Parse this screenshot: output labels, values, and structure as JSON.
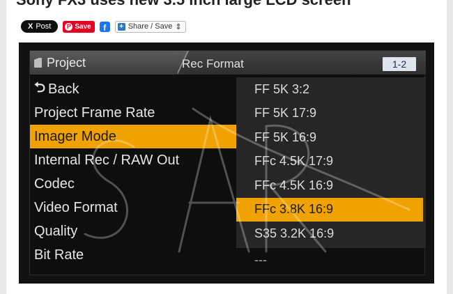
{
  "article": {
    "headline": "Sony FX3 uses new 3.5 inch large LCD screen"
  },
  "share": {
    "x_post_label": "Post",
    "x_glyph": "X",
    "pinterest_label": "Save",
    "facebook_glyph": "f",
    "share_save_label": "Share / Save",
    "share_save_caret": "⇕"
  },
  "camera_menu": {
    "project_tab": "Project",
    "section_title": "Rec Format",
    "page_indicator": "1-2",
    "back_label": "Back",
    "left_items": [
      {
        "label": "Project Frame Rate",
        "selected": false
      },
      {
        "label": "Imager Mode",
        "selected": true
      },
      {
        "label": "Internal Rec / RAW Out",
        "selected": false
      },
      {
        "label": "Codec",
        "selected": false
      },
      {
        "label": "Video Format",
        "selected": false
      },
      {
        "label": "Quality",
        "selected": false
      },
      {
        "label": "Bit Rate",
        "selected": false
      }
    ],
    "options": [
      {
        "label": "FF 5K 3:2",
        "selected": false
      },
      {
        "label": "FF 5K 17:9",
        "selected": false
      },
      {
        "label": "FF 5K 16:9",
        "selected": false
      },
      {
        "label": "FFc 4.5K 17:9",
        "selected": false
      },
      {
        "label": "FFc 4.5K 16:9",
        "selected": false
      },
      {
        "label": "FFc 3.8K 16:9",
        "selected": true
      },
      {
        "label": "S35 3.2K 16:9",
        "selected": false
      }
    ],
    "bit_rate_value": "---"
  },
  "colors": {
    "highlight": "#f0a200",
    "menu_bg": "#0e0e0e",
    "panel_bg": "#262626"
  }
}
